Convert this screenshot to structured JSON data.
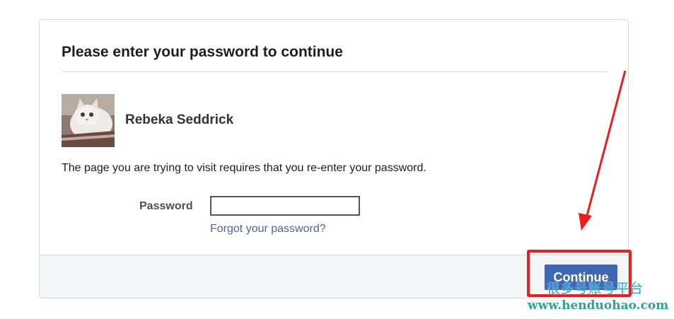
{
  "dialog": {
    "title": "Please enter your password to continue",
    "user": {
      "name": "Rebeka Seddrick",
      "avatar_icon": "cat-photo"
    },
    "message": "The page you are trying to visit requires that you re-enter your password.",
    "password": {
      "label": "Password",
      "value": "",
      "placeholder": ""
    },
    "forgot_link": "Forgot your password?",
    "continue_label": "Continue"
  },
  "annotation": {
    "color": "#ee1c1c"
  },
  "watermark": {
    "text_cn": "很多号账号平台",
    "url": "www.henduohao.com"
  },
  "colors": {
    "button": "#4267b2",
    "link": "#4b67a1",
    "footer": "#f5f6f7"
  }
}
